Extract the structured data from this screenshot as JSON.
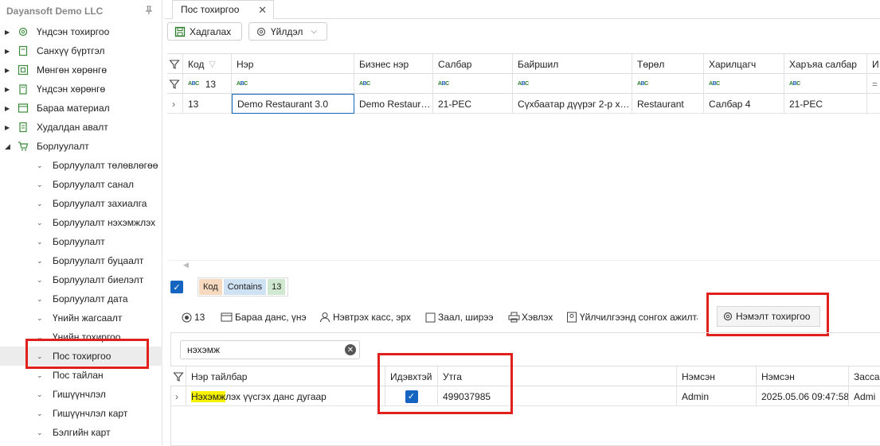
{
  "company": "Dayansoft Demo LLC",
  "sidebar": {
    "items": [
      {
        "label": "Үндсэн тохиргоо",
        "icon": "gear-icon"
      },
      {
        "label": "Санхүү бүртгэл",
        "icon": "ledger-icon"
      },
      {
        "label": "Мөнгөн хөрөнгө",
        "icon": "cash-icon"
      },
      {
        "label": "Үндсэн хөрөнгө",
        "icon": "building-icon"
      },
      {
        "label": "Бараа материал",
        "icon": "box-icon"
      },
      {
        "label": "Худалдан авалт",
        "icon": "receipt-icon"
      },
      {
        "label": "Борлуулалт",
        "icon": "cart-icon"
      }
    ],
    "sub_items": [
      "Борлуулалт төлөвлөгөө",
      "Борлуулалт санал",
      "Борлуулалт захиалга",
      "Борлуулалт нэхэмжлэх",
      "Борлуулалт",
      "Борлуулалт буцаалт",
      "Борлуулалт биелэлт",
      "Борлуулалт дата",
      "Үнийн жагсаалт",
      "Үнийн тохиргоо",
      "Пос тохиргоо",
      "Пос тайлан",
      "Гишүүнчлэл",
      "Гишүүнчлэл карт",
      "Бэлгийн карт"
    ],
    "selected_sub": "Пос тохиргоо"
  },
  "tab": {
    "title": "Пос тохиргоо"
  },
  "toolbar": {
    "save_label": "Хадгалах",
    "action_label": "Үйлдэл"
  },
  "grid": {
    "columns": [
      "Код",
      "Нэр",
      "Бизнес нэр",
      "Салбар",
      "Байршил",
      "Төрөл",
      "Харилцагч",
      "Харъяа салбар",
      "И"
    ],
    "filter_code": "13",
    "rows": [
      {
        "code": "13",
        "name": "Demo Restaurant 3.0",
        "business": "Demo Restaur…",
        "branch": "21-РЕС",
        "location": "Сүхбаатар дүүрэг 2-р х…",
        "type": "Restaurant",
        "partner": "Салбар 4",
        "parent_branch": "21-РЕС"
      }
    ]
  },
  "filter": {
    "field": "Код",
    "op": "Contains",
    "value": "13"
  },
  "subtabs": {
    "record": "13",
    "items": [
      "Бараа данс, үнэ",
      "Нэвтрэх касс, эрх",
      "Заал, ширээ",
      "Хэвлэх",
      "Үйлчилгээнд сонгох ажилтан",
      "Нэмэлт тохиргоо"
    ]
  },
  "detail": {
    "search_value": "нэхэмж",
    "columns": [
      "Нэр тайлбар",
      "Идэвхтэй",
      "Утга",
      "Нэмсэн",
      "Нэмсэн",
      "Засса"
    ],
    "rows": [
      {
        "name_hl": "Нэхэмж",
        "name_rest": "лэх үүсгэх данс дугаар",
        "active": true,
        "value": "499037985",
        "added_by": "Admin",
        "added_at": "2025.05.06 09:47:58",
        "edited_by": "Admi"
      }
    ]
  },
  "colors": {
    "accent": "#1565c0",
    "highlight_box": "#e0201c",
    "chip_code": "#f7d9bf",
    "chip_op": "#cfe2f3",
    "chip_val": "#cfe8cf"
  }
}
